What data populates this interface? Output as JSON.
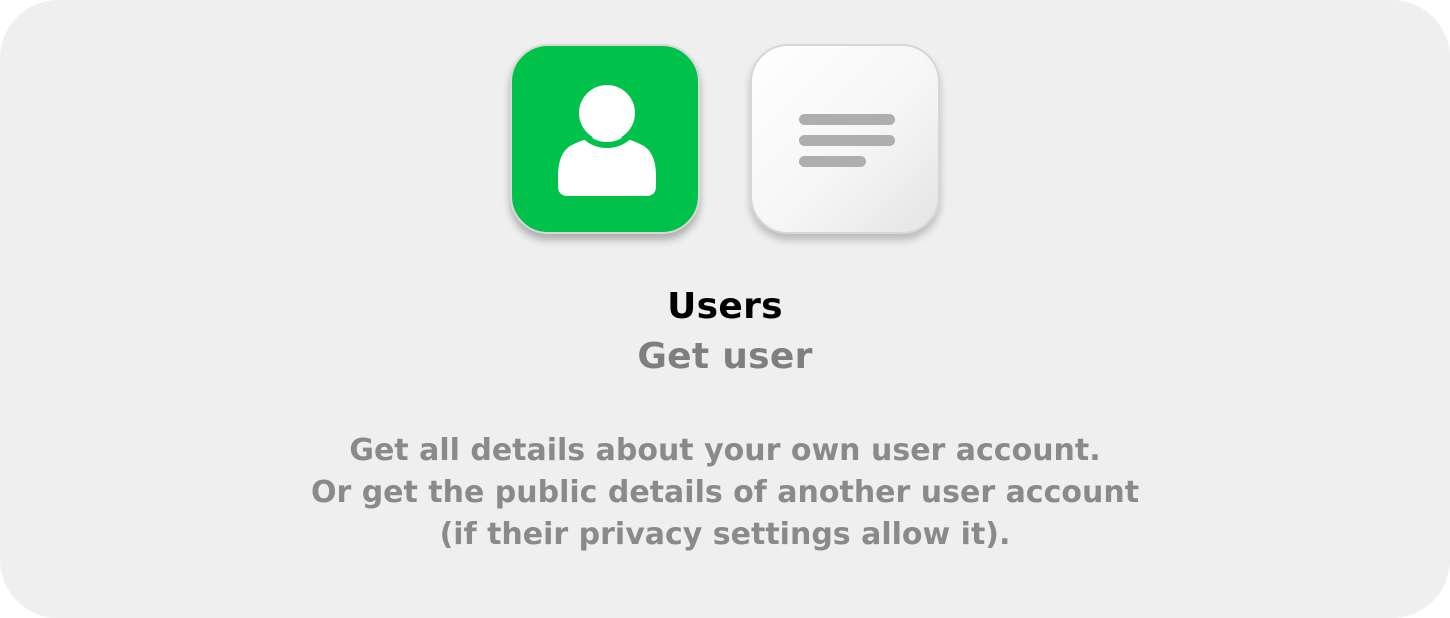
{
  "colors": {
    "background": "#efefef",
    "users_icon_bg": "#00c14a",
    "title": "#000000",
    "subtitle": "#7f7f7f",
    "description": "#8a8a8a"
  },
  "icons": {
    "users": "user-silhouette-icon",
    "action": "text-lines-icon"
  },
  "app": {
    "title": "Users",
    "action": "Get user"
  },
  "description": {
    "lines": [
      "Get all details about your own user account.",
      "Or get the public details of another user account",
      "(if their privacy settings allow it)."
    ]
  }
}
